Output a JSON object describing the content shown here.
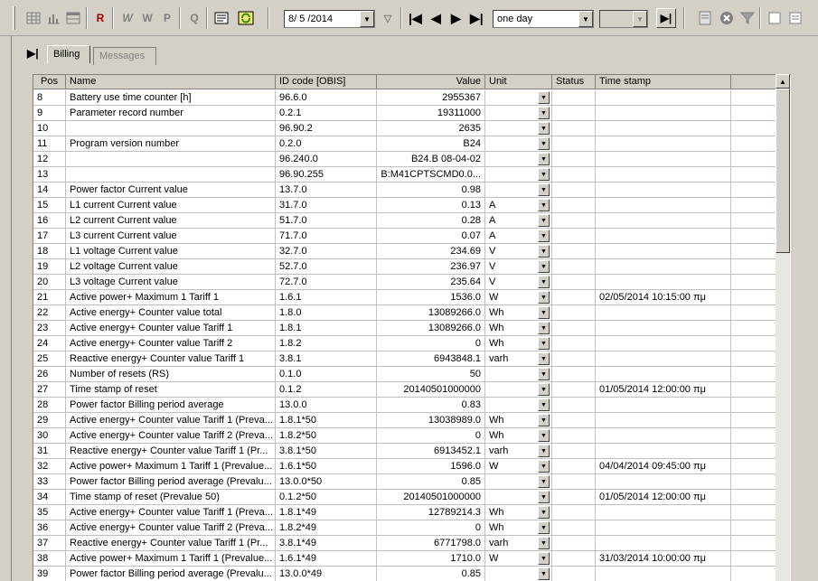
{
  "toolbar": {
    "icons": [
      "grid-icon",
      "chart-icon",
      "table-icon",
      "read-icon",
      "write-all-icon",
      "write-icon",
      "parameter-icon",
      "query-icon",
      "list-icon",
      "refresh-icon"
    ],
    "letters": {
      "read": "R",
      "write_all": "W",
      "write": "W",
      "parameter": "P",
      "query": "Q"
    },
    "date_value": "8/ 5 /2014",
    "period_value": "one day",
    "nav_first": "|◀",
    "nav_prev": "◀",
    "nav_next": "▶",
    "nav_last": "▶|",
    "play": "▶|"
  },
  "tabs": {
    "marker": "▶|",
    "billing": "Billing",
    "messages": "Messages"
  },
  "grid": {
    "columns": [
      "Pos",
      "Name",
      "ID code [OBIS]",
      "Value",
      "Unit",
      "Status",
      "Time stamp"
    ],
    "rows": [
      {
        "pos": "8",
        "name": "Battery use time counter [h]",
        "id": "96.6.0",
        "value": "2955367",
        "unit": "",
        "ts": ""
      },
      {
        "pos": "9",
        "name": "Parameter record number",
        "id": "0.2.1",
        "value": "19311000",
        "unit": "",
        "ts": ""
      },
      {
        "pos": "10",
        "name": "",
        "id": "96.90.2",
        "value": "2635",
        "unit": "",
        "ts": ""
      },
      {
        "pos": "11",
        "name": "Program version number",
        "id": "0.2.0",
        "value": "B24",
        "unit": "",
        "ts": ""
      },
      {
        "pos": "12",
        "name": "",
        "id": "96.240.0",
        "value": "B24.B 08-04-02",
        "unit": "",
        "ts": ""
      },
      {
        "pos": "13",
        "name": "",
        "id": "96.90.255",
        "value": "B:M41CPTSCMD0.0...",
        "unit": "",
        "ts": ""
      },
      {
        "pos": "14",
        "name": "Power factor Current value",
        "id": "13.7.0",
        "value": "0.98",
        "unit": "",
        "ts": ""
      },
      {
        "pos": "15",
        "name": "L1 current Current value",
        "id": "31.7.0",
        "value": "0.13",
        "unit": "A",
        "ts": ""
      },
      {
        "pos": "16",
        "name": "L2 current Current value",
        "id": "51.7.0",
        "value": "0.28",
        "unit": "A",
        "ts": ""
      },
      {
        "pos": "17",
        "name": "L3 current Current value",
        "id": "71.7.0",
        "value": "0.07",
        "unit": "A",
        "ts": ""
      },
      {
        "pos": "18",
        "name": "L1 voltage Current value",
        "id": "32.7.0",
        "value": "234.69",
        "unit": "V",
        "ts": ""
      },
      {
        "pos": "19",
        "name": "L2 voltage Current value",
        "id": "52.7.0",
        "value": "236.97",
        "unit": "V",
        "ts": ""
      },
      {
        "pos": "20",
        "name": "L3 voltage Current value",
        "id": "72.7.0",
        "value": "235.64",
        "unit": "V",
        "ts": ""
      },
      {
        "pos": "21",
        "name": "Active power+ Maximum 1 Tariff 1",
        "id": "1.6.1",
        "value": "1536.0",
        "unit": "W",
        "ts": "02/05/2014 10:15:00 πμ"
      },
      {
        "pos": "22",
        "name": "Active energy+ Counter value total",
        "id": "1.8.0",
        "value": "13089266.0",
        "unit": "Wh",
        "ts": ""
      },
      {
        "pos": "23",
        "name": "Active energy+ Counter value Tariff 1",
        "id": "1.8.1",
        "value": "13089266.0",
        "unit": "Wh",
        "ts": ""
      },
      {
        "pos": "24",
        "name": "Active energy+ Counter value Tariff 2",
        "id": "1.8.2",
        "value": "0",
        "unit": "Wh",
        "ts": ""
      },
      {
        "pos": "25",
        "name": "Reactive energy+ Counter value Tariff 1",
        "id": "3.8.1",
        "value": "6943848.1",
        "unit": "varh",
        "ts": ""
      },
      {
        "pos": "26",
        "name": "Number of resets (RS)",
        "id": "0.1.0",
        "value": "50",
        "unit": "",
        "ts": ""
      },
      {
        "pos": "27",
        "name": "Time stamp of reset",
        "id": "0.1.2",
        "value": "20140501000000",
        "unit": "",
        "ts": "01/05/2014 12:00:00 πμ"
      },
      {
        "pos": "28",
        "name": "Power factor Billing period average",
        "id": "13.0.0",
        "value": "0.83",
        "unit": "",
        "ts": ""
      },
      {
        "pos": "29",
        "name": "Active energy+ Counter value Tariff 1 (Preva...",
        "id": "1.8.1*50",
        "value": "13038989.0",
        "unit": "Wh",
        "ts": ""
      },
      {
        "pos": "30",
        "name": "Active energy+ Counter value Tariff 2 (Preva...",
        "id": "1.8.2*50",
        "value": "0",
        "unit": "Wh",
        "ts": ""
      },
      {
        "pos": "31",
        "name": "Reactive energy+ Counter value Tariff 1 (Pr...",
        "id": "3.8.1*50",
        "value": "6913452.1",
        "unit": "varh",
        "ts": ""
      },
      {
        "pos": "32",
        "name": "Active power+ Maximum 1 Tariff 1 (Prevalue...",
        "id": "1.6.1*50",
        "value": "1596.0",
        "unit": "W",
        "ts": "04/04/2014 09:45:00 πμ"
      },
      {
        "pos": "33",
        "name": "Power factor Billing period average (Prevalu...",
        "id": "13.0.0*50",
        "value": "0.85",
        "unit": "",
        "ts": ""
      },
      {
        "pos": "34",
        "name": "Time stamp of reset (Prevalue 50)",
        "id": "0.1.2*50",
        "value": "20140501000000",
        "unit": "",
        "ts": "01/05/2014 12:00:00 πμ"
      },
      {
        "pos": "35",
        "name": "Active energy+ Counter value Tariff 1 (Preva...",
        "id": "1.8.1*49",
        "value": "12789214.3",
        "unit": "Wh",
        "ts": ""
      },
      {
        "pos": "36",
        "name": "Active energy+ Counter value Tariff 2 (Preva...",
        "id": "1.8.2*49",
        "value": "0",
        "unit": "Wh",
        "ts": ""
      },
      {
        "pos": "37",
        "name": "Reactive energy+ Counter value Tariff 1 (Pr...",
        "id": "3.8.1*49",
        "value": "6771798.0",
        "unit": "varh",
        "ts": ""
      },
      {
        "pos": "38",
        "name": "Active power+ Maximum 1 Tariff 1 (Prevalue...",
        "id": "1.6.1*49",
        "value": "1710.0",
        "unit": "W",
        "ts": "31/03/2014 10:00:00 πμ"
      },
      {
        "pos": "39",
        "name": "Power factor Billing period average (Prevalu...",
        "id": "13.0.0*49",
        "value": "0.85",
        "unit": "",
        "ts": ""
      }
    ]
  },
  "colors": {
    "read_accent": "#a00000",
    "refresh_accent": "#2a8a2a",
    "background": "#d4d0c8"
  }
}
